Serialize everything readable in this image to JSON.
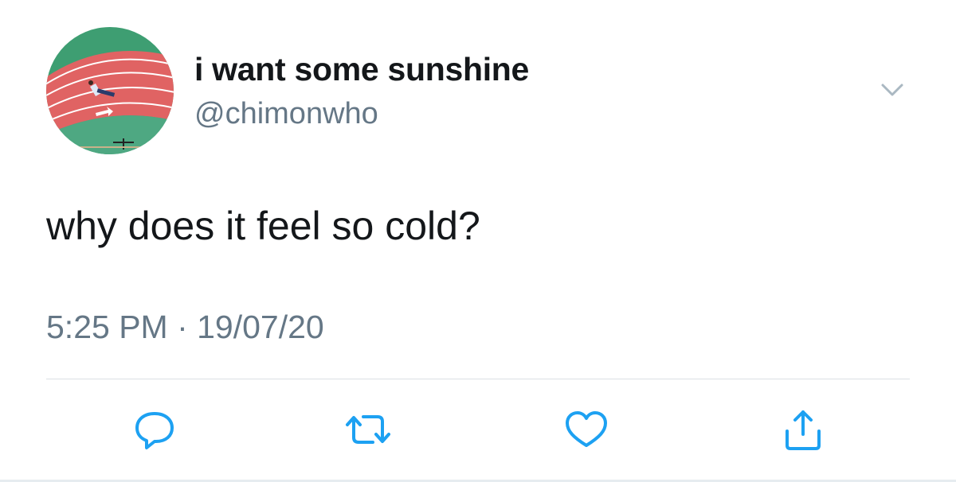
{
  "user": {
    "display_name": "i want some sunshine",
    "handle": "@chimonwho"
  },
  "tweet": {
    "text": "why does it feel so cold?",
    "timestamp": "5:25 PM · 19/07/20"
  },
  "actions": [
    {
      "name": "reply",
      "icon": "reply-icon"
    },
    {
      "name": "retweet",
      "icon": "retweet-icon"
    },
    {
      "name": "like",
      "icon": "heart-icon"
    },
    {
      "name": "share",
      "icon": "share-icon"
    }
  ],
  "colors": {
    "text_primary": "#14171a",
    "text_secondary": "#657786",
    "divider": "#dbe0e4",
    "icon": "#1da1f2"
  }
}
